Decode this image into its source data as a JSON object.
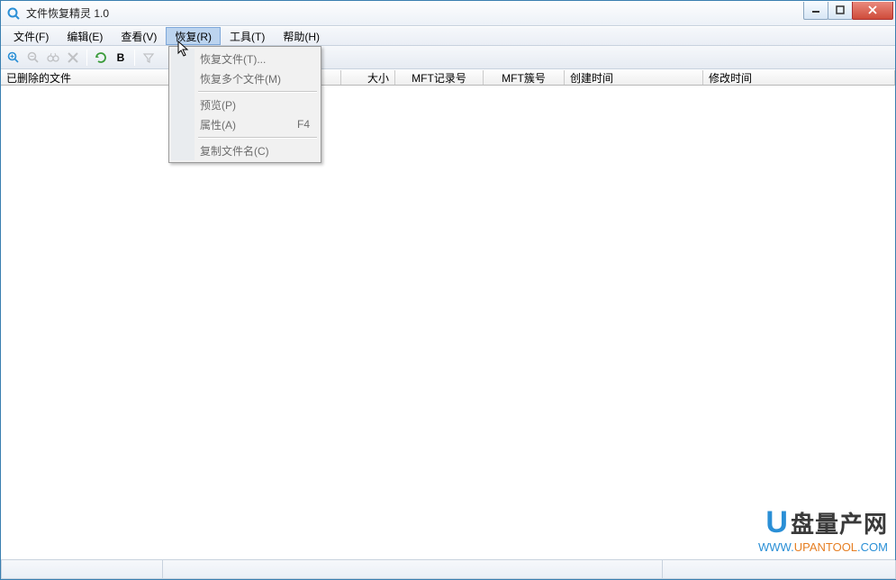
{
  "window": {
    "title": "文件恢复精灵 1.0"
  },
  "menubar": {
    "items": [
      "文件(F)",
      "编辑(E)",
      "查看(V)",
      "恢复(R)",
      "工具(T)",
      "帮助(H)"
    ],
    "active_index": 3
  },
  "dropdown": {
    "items": [
      {
        "label": "恢复文件(T)...",
        "shortcut": ""
      },
      {
        "label": "恢复多个文件(M)",
        "shortcut": ""
      },
      {
        "sep": true
      },
      {
        "label": "预览(P)",
        "shortcut": ""
      },
      {
        "label": "属性(A)",
        "shortcut": "F4"
      },
      {
        "sep": true
      },
      {
        "label": "复制文件名(C)",
        "shortcut": ""
      }
    ]
  },
  "toolbar": {
    "refresh_icon": "refresh",
    "b_label": "B"
  },
  "columns": [
    "已删除的文件",
    "大小",
    "MFT记录号",
    "MFT簇号",
    "创建时间",
    "修改时间"
  ],
  "watermark": {
    "brand_u": "U",
    "brand_rest": "盘量产网",
    "url_prefix": "WWW.",
    "url_mid": "UPANTOOL",
    "url_suffix": ".COM"
  }
}
